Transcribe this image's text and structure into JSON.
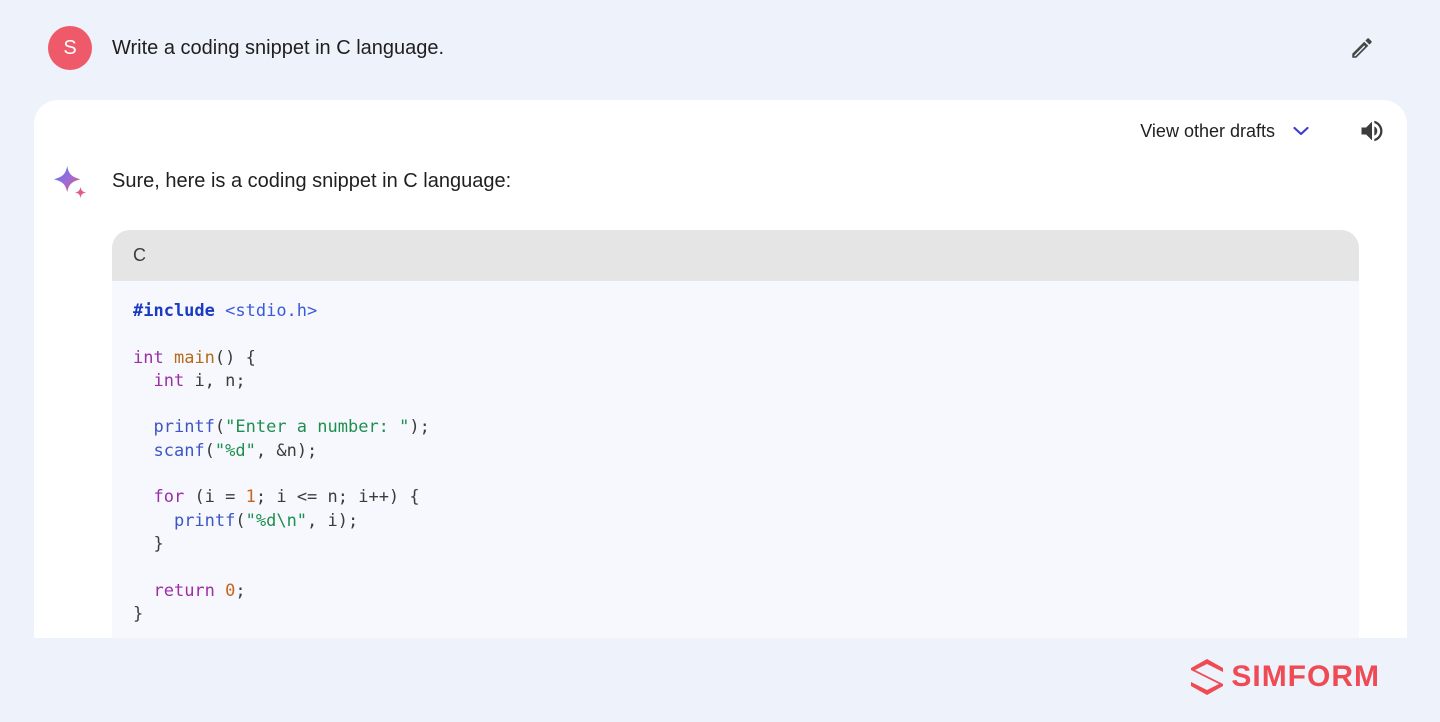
{
  "user": {
    "avatar_letter": "S",
    "prompt": "Write a coding snippet in C language."
  },
  "response": {
    "drafts_label": "View other drafts",
    "intro": "Sure, here is a coding snippet in C language:",
    "code_language": "C",
    "code_lines": [
      [
        {
          "t": "#include",
          "c": "pre"
        },
        {
          "t": " ",
          "c": "plain"
        },
        {
          "t": "<stdio.h>",
          "c": "hdr"
        }
      ],
      [],
      [
        {
          "t": "int",
          "c": "kw"
        },
        {
          "t": " ",
          "c": "plain"
        },
        {
          "t": "main",
          "c": "fn"
        },
        {
          "t": "() {",
          "c": "plain"
        }
      ],
      [
        {
          "t": "  ",
          "c": "plain"
        },
        {
          "t": "int",
          "c": "kw"
        },
        {
          "t": " i, n;",
          "c": "plain"
        }
      ],
      [],
      [
        {
          "t": "  ",
          "c": "plain"
        },
        {
          "t": "printf",
          "c": "call"
        },
        {
          "t": "(",
          "c": "plain"
        },
        {
          "t": "\"Enter a number: \"",
          "c": "str"
        },
        {
          "t": ");",
          "c": "plain"
        }
      ],
      [
        {
          "t": "  ",
          "c": "plain"
        },
        {
          "t": "scanf",
          "c": "call"
        },
        {
          "t": "(",
          "c": "plain"
        },
        {
          "t": "\"%d\"",
          "c": "str"
        },
        {
          "t": ", &n);",
          "c": "plain"
        }
      ],
      [],
      [
        {
          "t": "  ",
          "c": "plain"
        },
        {
          "t": "for",
          "c": "kw"
        },
        {
          "t": " (i = ",
          "c": "plain"
        },
        {
          "t": "1",
          "c": "num"
        },
        {
          "t": "; i <= n; i++) {",
          "c": "plain"
        }
      ],
      [
        {
          "t": "    ",
          "c": "plain"
        },
        {
          "t": "printf",
          "c": "call"
        },
        {
          "t": "(",
          "c": "plain"
        },
        {
          "t": "\"%d\\n\"",
          "c": "str"
        },
        {
          "t": ", i);",
          "c": "plain"
        }
      ],
      [
        {
          "t": "  }",
          "c": "plain"
        }
      ],
      [],
      [
        {
          "t": "  ",
          "c": "plain"
        },
        {
          "t": "return",
          "c": "kw"
        },
        {
          "t": " ",
          "c": "plain"
        },
        {
          "t": "0",
          "c": "num"
        },
        {
          "t": ";",
          "c": "plain"
        }
      ],
      [
        {
          "t": "}",
          "c": "plain"
        }
      ]
    ]
  },
  "brand": {
    "name": "SIMFORM"
  },
  "icons": {
    "edit": "pencil-icon",
    "drafts_toggle": "chevron-down-icon",
    "read_aloud": "speaker-icon",
    "assistant": "sparkle-icon",
    "brand_mark": "simform-logo-icon"
  },
  "colors": {
    "background": "#eef2fb",
    "avatar": "#ef5a6a",
    "chevron": "#3b3fc7",
    "brand": "#ef4b55",
    "code_keyword": "#9a2fa6",
    "code_string": "#1f8f4f",
    "code_number": "#c7651f",
    "code_function": "#3c56c4"
  }
}
